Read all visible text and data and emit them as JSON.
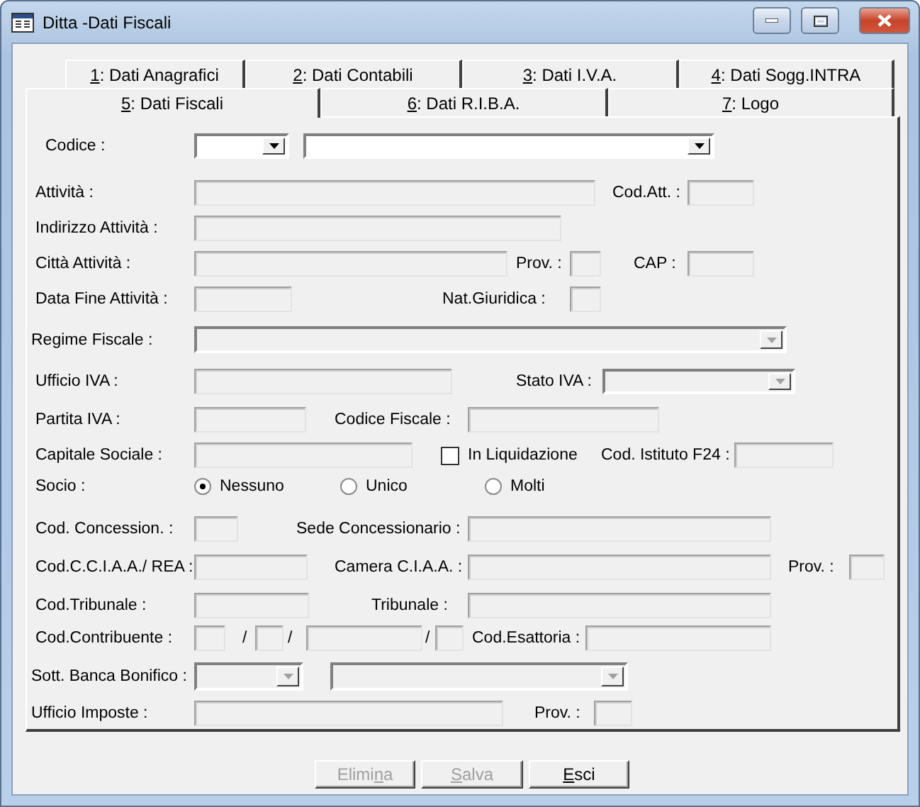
{
  "window": {
    "title": "Ditta -Dati Fiscali"
  },
  "tab_rows": [
    {
      "tabs": [
        {
          "hotkey": "1",
          "text": ": Dati Anagrafici",
          "selected": false
        },
        {
          "hotkey": "2",
          "text": ": Dati Contabili",
          "selected": false
        },
        {
          "hotkey": "3",
          "text": ": Dati I.V.A.",
          "selected": false
        },
        {
          "hotkey": "4",
          "text": ": Dati Sogg.INTRA",
          "selected": false
        }
      ]
    },
    {
      "tabs": [
        {
          "hotkey": "5",
          "text": ": Dati Fiscali",
          "selected": true
        },
        {
          "hotkey": "6",
          "text": ": Dati R.I.B.A.",
          "selected": false
        },
        {
          "hotkey": "7",
          "text": ": Logo",
          "selected": false
        }
      ]
    }
  ],
  "form_rows": [
    {
      "items": [
        {
          "kind": "label",
          "text": "Codice :"
        },
        {
          "kind": "combo",
          "disabled": false
        },
        {
          "kind": "combo",
          "disabled": false
        }
      ]
    },
    {
      "items": [
        {
          "kind": "label",
          "text": "Attività :"
        },
        {
          "kind": "field",
          "disabled": true
        },
        {
          "kind": "label",
          "text": "Cod.Att. :"
        },
        {
          "kind": "field",
          "disabled": true
        }
      ]
    },
    {
      "items": [
        {
          "kind": "label",
          "text": "Indirizzo Attività :"
        },
        {
          "kind": "field",
          "disabled": true
        }
      ]
    },
    {
      "items": [
        {
          "kind": "label",
          "text": "Città Attività :"
        },
        {
          "kind": "field",
          "disabled": true
        },
        {
          "kind": "label",
          "text": "Prov. :"
        },
        {
          "kind": "field",
          "disabled": true
        },
        {
          "kind": "label",
          "text": "CAP :"
        },
        {
          "kind": "field",
          "disabled": true
        }
      ]
    },
    {
      "items": [
        {
          "kind": "label",
          "text": "Data Fine Attività :"
        },
        {
          "kind": "field",
          "disabled": true
        },
        {
          "kind": "label",
          "text": "Nat.Giuridica :"
        },
        {
          "kind": "field",
          "disabled": true
        }
      ]
    },
    {
      "items": [
        {
          "kind": "label",
          "text": "Regime Fiscale :"
        },
        {
          "kind": "combo",
          "disabled": true
        }
      ]
    },
    {
      "items": [
        {
          "kind": "label",
          "text": "Ufficio IVA :"
        },
        {
          "kind": "field",
          "disabled": true
        },
        {
          "kind": "label",
          "text": "Stato  IVA :"
        },
        {
          "kind": "combo",
          "disabled": true
        }
      ]
    },
    {
      "items": [
        {
          "kind": "label",
          "text": "Partita IVA :"
        },
        {
          "kind": "field",
          "disabled": true
        },
        {
          "kind": "label",
          "text": "Codice  Fiscale :"
        },
        {
          "kind": "field",
          "disabled": true
        }
      ]
    },
    {
      "items": [
        {
          "kind": "label",
          "text": "Capitale Sociale :"
        },
        {
          "kind": "field",
          "disabled": true
        },
        {
          "kind": "check",
          "text": "In Liquidazione",
          "checked": false
        },
        {
          "kind": "label",
          "text": "Cod. Istituto F24 :"
        },
        {
          "kind": "field",
          "disabled": true
        }
      ]
    },
    {
      "items": [
        {
          "kind": "label",
          "text": "Socio :"
        },
        {
          "kind": "radio",
          "text": "Nessuno",
          "selected": true
        },
        {
          "kind": "radio",
          "text": "Unico",
          "selected": false
        },
        {
          "kind": "radio",
          "text": "Molti",
          "selected": false
        }
      ]
    },
    {
      "items": [
        {
          "kind": "label",
          "text": "Cod. Concession. :"
        },
        {
          "kind": "field",
          "disabled": true
        },
        {
          "kind": "label",
          "text": "Sede Concessionario :"
        },
        {
          "kind": "field",
          "disabled": true
        }
      ]
    },
    {
      "items": [
        {
          "kind": "label",
          "text": "Cod.C.C.I.A.A./ REA :"
        },
        {
          "kind": "field",
          "disabled": true
        },
        {
          "kind": "label",
          "text": "Camera C.I.A.A. :"
        },
        {
          "kind": "field",
          "disabled": true
        },
        {
          "kind": "label",
          "text": "Prov. :"
        },
        {
          "kind": "field",
          "disabled": true
        }
      ]
    },
    {
      "items": [
        {
          "kind": "label",
          "text": "Cod.Tribunale :"
        },
        {
          "kind": "field",
          "disabled": true
        },
        {
          "kind": "label",
          "text": "Tribunale :"
        },
        {
          "kind": "field",
          "disabled": true
        }
      ]
    },
    {
      "items": [
        {
          "kind": "label",
          "text": "Cod.Contribuente :"
        },
        {
          "kind": "field",
          "disabled": true
        },
        {
          "kind": "label",
          "text": "/"
        },
        {
          "kind": "field",
          "disabled": true
        },
        {
          "kind": "label",
          "text": "/"
        },
        {
          "kind": "field",
          "disabled": true
        },
        {
          "kind": "label",
          "text": "/"
        },
        {
          "kind": "field",
          "disabled": true
        },
        {
          "kind": "label",
          "text": "Cod.Esattoria :"
        },
        {
          "kind": "field",
          "disabled": true
        }
      ]
    },
    {
      "items": [
        {
          "kind": "label",
          "text": "Sott. Banca Bonifico :"
        },
        {
          "kind": "combo",
          "disabled": true
        },
        {
          "kind": "combo",
          "disabled": true
        }
      ]
    },
    {
      "items": [
        {
          "kind": "label",
          "text": "Ufficio Imposte :"
        },
        {
          "kind": "field",
          "disabled": true
        },
        {
          "kind": "label",
          "text": "Prov. :"
        },
        {
          "kind": "field",
          "disabled": true
        }
      ]
    }
  ],
  "buttons": [
    {
      "pre": "Elimi",
      "hotkey": "n",
      "post": "a",
      "disabled": true
    },
    {
      "hotkey": "S",
      "post": "alva",
      "disabled": true
    },
    {
      "hotkey": "E",
      "post": "sci",
      "disabled": false
    }
  ]
}
